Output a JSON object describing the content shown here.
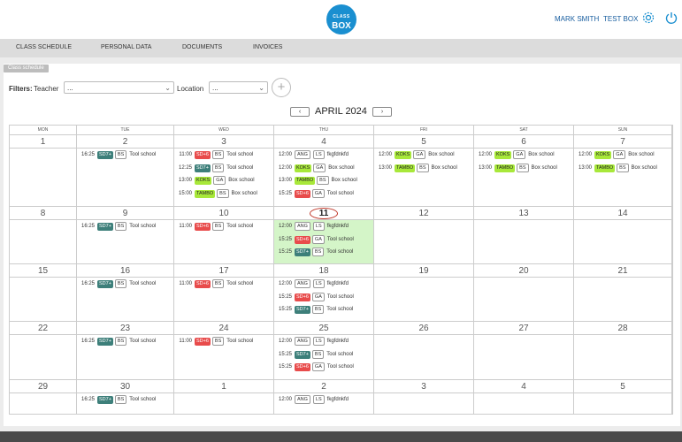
{
  "header": {
    "logo_line1": "CLASS",
    "logo_line2": "BOX",
    "user_name": "MARK SMITH",
    "box_name": "TEST BOX",
    "icons": [
      "settings-icon",
      "power-icon"
    ]
  },
  "nav": {
    "items": [
      "CLASS SCHEDULE",
      "PERSONAL DATA",
      "DOCUMENTS",
      "INVOICES"
    ]
  },
  "section_tag": "Class schedule",
  "filters": {
    "label": "Filters:",
    "teacher_label": "Teacher",
    "teacher_value": "...",
    "location_label": "Location",
    "location_value": "...",
    "add_symbol": "+"
  },
  "calendar": {
    "prev_symbol": "‹",
    "next_symbol": "›",
    "month_title": "APRIL 2024",
    "weekdays": [
      "MON",
      "TUE",
      "WED",
      "THU",
      "FRI",
      "SAT",
      "SUN"
    ],
    "colors": {
      "SD7+": "#3d7f7a",
      "SD+6": "#e84b4b",
      "KOKS": "#a8e83a",
      "TAMBO": "#a8e83a"
    },
    "weeks": [
      {
        "days": [
          {
            "day": "1",
            "events": []
          },
          {
            "day": "2",
            "events": [
              {
                "time": "16:25",
                "cls": "SD7+",
                "room": "BS",
                "name": "Tool school"
              }
            ]
          },
          {
            "day": "3",
            "events": [
              {
                "time": "11:00",
                "cls": "SD+6",
                "room": "BS",
                "name": "Tool school"
              },
              {
                "time": "12:25",
                "cls": "SD7+",
                "room": "BS",
                "name": "Tool school"
              },
              {
                "time": "13:00",
                "cls": "KOKS",
                "room": "GA",
                "name": "Box school"
              },
              {
                "time": "15:00",
                "cls": "TAMBO",
                "room": "BS",
                "name": "Box school"
              }
            ]
          },
          {
            "day": "4",
            "events": [
              {
                "time": "12:00",
                "cls": "ANG",
                "room": "LS",
                "name": "fkgfdnkfd"
              },
              {
                "time": "12:00",
                "cls": "KOKS",
                "room": "GA",
                "name": "Box school"
              },
              {
                "time": "13:00",
                "cls": "TAMBO",
                "room": "BS",
                "name": "Box school"
              },
              {
                "time": "15:25",
                "cls": "SD+6",
                "room": "GA",
                "name": "Tool school"
              }
            ]
          },
          {
            "day": "5",
            "events": [
              {
                "time": "12:00",
                "cls": "KOKS",
                "room": "GA",
                "name": "Box school"
              },
              {
                "time": "13:00",
                "cls": "TAMBO",
                "room": "BS",
                "name": "Box school"
              }
            ]
          },
          {
            "day": "6",
            "events": [
              {
                "time": "12:00",
                "cls": "KOKS",
                "room": "GA",
                "name": "Box school"
              },
              {
                "time": "13:00",
                "cls": "TAMBO",
                "room": "BS",
                "name": "Box school"
              }
            ]
          },
          {
            "day": "7",
            "events": [
              {
                "time": "12:00",
                "cls": "KOKS",
                "room": "GA",
                "name": "Box school"
              },
              {
                "time": "13:00",
                "cls": "TAMBO",
                "room": "BS",
                "name": "Box school"
              }
            ]
          }
        ]
      },
      {
        "days": [
          {
            "day": "8",
            "events": []
          },
          {
            "day": "9",
            "events": [
              {
                "time": "16:25",
                "cls": "SD7+",
                "room": "BS",
                "name": "Tool school"
              }
            ]
          },
          {
            "day": "10",
            "events": [
              {
                "time": "11:00",
                "cls": "SD+6",
                "room": "BS",
                "name": "Tool school"
              }
            ]
          },
          {
            "day": "11",
            "today": true,
            "events": [
              {
                "time": "12:00",
                "cls": "ANG",
                "room": "LS",
                "name": "fkgfdnkfd"
              },
              {
                "time": "15:25",
                "cls": "SD+6",
                "room": "GA",
                "name": "Tool school"
              },
              {
                "time": "15:25",
                "cls": "SD7+",
                "room": "BS",
                "name": "Tool school"
              }
            ]
          },
          {
            "day": "12",
            "events": []
          },
          {
            "day": "13",
            "events": []
          },
          {
            "day": "14",
            "events": []
          }
        ]
      },
      {
        "days": [
          {
            "day": "15",
            "events": []
          },
          {
            "day": "16",
            "events": [
              {
                "time": "16:25",
                "cls": "SD7+",
                "room": "BS",
                "name": "Tool school"
              }
            ]
          },
          {
            "day": "17",
            "events": [
              {
                "time": "11:00",
                "cls": "SD+6",
                "room": "BS",
                "name": "Tool school"
              }
            ]
          },
          {
            "day": "18",
            "events": [
              {
                "time": "12:00",
                "cls": "ANG",
                "room": "LS",
                "name": "fkgfdnkfd"
              },
              {
                "time": "15:25",
                "cls": "SD+6",
                "room": "GA",
                "name": "Tool school"
              },
              {
                "time": "15:25",
                "cls": "SD7+",
                "room": "BS",
                "name": "Tool school"
              }
            ]
          },
          {
            "day": "19",
            "events": []
          },
          {
            "day": "20",
            "events": []
          },
          {
            "day": "21",
            "events": []
          }
        ]
      },
      {
        "days": [
          {
            "day": "22",
            "events": []
          },
          {
            "day": "23",
            "events": [
              {
                "time": "16:25",
                "cls": "SD7+",
                "room": "BS",
                "name": "Tool school"
              }
            ]
          },
          {
            "day": "24",
            "events": [
              {
                "time": "11:00",
                "cls": "SD+6",
                "room": "BS",
                "name": "Tool school"
              }
            ]
          },
          {
            "day": "25",
            "events": [
              {
                "time": "12:00",
                "cls": "ANG",
                "room": "LS",
                "name": "fkgfdnkfd"
              },
              {
                "time": "15:25",
                "cls": "SD7+",
                "room": "BS",
                "name": "Tool school"
              },
              {
                "time": "15:25",
                "cls": "SD+6",
                "room": "GA",
                "name": "Tool school"
              }
            ]
          },
          {
            "day": "26",
            "events": []
          },
          {
            "day": "27",
            "events": []
          },
          {
            "day": "28",
            "events": []
          }
        ]
      },
      {
        "days": [
          {
            "day": "29",
            "events": []
          },
          {
            "day": "30",
            "events": [
              {
                "time": "16:25",
                "cls": "SD7+",
                "room": "BS",
                "name": "Tool school"
              }
            ]
          },
          {
            "day": "1",
            "events": []
          },
          {
            "day": "2",
            "events": [
              {
                "time": "12:00",
                "cls": "ANG",
                "room": "LS",
                "name": "fkgfdnkfd"
              }
            ]
          },
          {
            "day": "3",
            "events": []
          },
          {
            "day": "4",
            "events": []
          },
          {
            "day": "5",
            "events": []
          }
        ]
      }
    ]
  }
}
